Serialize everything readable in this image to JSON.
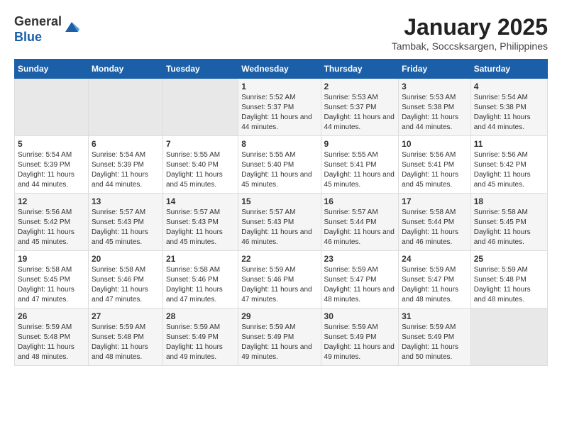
{
  "logo": {
    "general": "General",
    "blue": "Blue"
  },
  "title": "January 2025",
  "subtitle": "Tambak, Soccsksargen, Philippines",
  "headers": [
    "Sunday",
    "Monday",
    "Tuesday",
    "Wednesday",
    "Thursday",
    "Friday",
    "Saturday"
  ],
  "weeks": [
    [
      {
        "day": "",
        "sunrise": "",
        "sunset": "",
        "daylight": "",
        "empty": true
      },
      {
        "day": "",
        "sunrise": "",
        "sunset": "",
        "daylight": "",
        "empty": true
      },
      {
        "day": "",
        "sunrise": "",
        "sunset": "",
        "daylight": "",
        "empty": true
      },
      {
        "day": "1",
        "sunrise": "Sunrise: 5:52 AM",
        "sunset": "Sunset: 5:37 PM",
        "daylight": "Daylight: 11 hours and 44 minutes."
      },
      {
        "day": "2",
        "sunrise": "Sunrise: 5:53 AM",
        "sunset": "Sunset: 5:37 PM",
        "daylight": "Daylight: 11 hours and 44 minutes."
      },
      {
        "day": "3",
        "sunrise": "Sunrise: 5:53 AM",
        "sunset": "Sunset: 5:38 PM",
        "daylight": "Daylight: 11 hours and 44 minutes."
      },
      {
        "day": "4",
        "sunrise": "Sunrise: 5:54 AM",
        "sunset": "Sunset: 5:38 PM",
        "daylight": "Daylight: 11 hours and 44 minutes."
      }
    ],
    [
      {
        "day": "5",
        "sunrise": "Sunrise: 5:54 AM",
        "sunset": "Sunset: 5:39 PM",
        "daylight": "Daylight: 11 hours and 44 minutes."
      },
      {
        "day": "6",
        "sunrise": "Sunrise: 5:54 AM",
        "sunset": "Sunset: 5:39 PM",
        "daylight": "Daylight: 11 hours and 44 minutes."
      },
      {
        "day": "7",
        "sunrise": "Sunrise: 5:55 AM",
        "sunset": "Sunset: 5:40 PM",
        "daylight": "Daylight: 11 hours and 45 minutes."
      },
      {
        "day": "8",
        "sunrise": "Sunrise: 5:55 AM",
        "sunset": "Sunset: 5:40 PM",
        "daylight": "Daylight: 11 hours and 45 minutes."
      },
      {
        "day": "9",
        "sunrise": "Sunrise: 5:55 AM",
        "sunset": "Sunset: 5:41 PM",
        "daylight": "Daylight: 11 hours and 45 minutes."
      },
      {
        "day": "10",
        "sunrise": "Sunrise: 5:56 AM",
        "sunset": "Sunset: 5:41 PM",
        "daylight": "Daylight: 11 hours and 45 minutes."
      },
      {
        "day": "11",
        "sunrise": "Sunrise: 5:56 AM",
        "sunset": "Sunset: 5:42 PM",
        "daylight": "Daylight: 11 hours and 45 minutes."
      }
    ],
    [
      {
        "day": "12",
        "sunrise": "Sunrise: 5:56 AM",
        "sunset": "Sunset: 5:42 PM",
        "daylight": "Daylight: 11 hours and 45 minutes."
      },
      {
        "day": "13",
        "sunrise": "Sunrise: 5:57 AM",
        "sunset": "Sunset: 5:43 PM",
        "daylight": "Daylight: 11 hours and 45 minutes."
      },
      {
        "day": "14",
        "sunrise": "Sunrise: 5:57 AM",
        "sunset": "Sunset: 5:43 PM",
        "daylight": "Daylight: 11 hours and 45 minutes."
      },
      {
        "day": "15",
        "sunrise": "Sunrise: 5:57 AM",
        "sunset": "Sunset: 5:43 PM",
        "daylight": "Daylight: 11 hours and 46 minutes."
      },
      {
        "day": "16",
        "sunrise": "Sunrise: 5:57 AM",
        "sunset": "Sunset: 5:44 PM",
        "daylight": "Daylight: 11 hours and 46 minutes."
      },
      {
        "day": "17",
        "sunrise": "Sunrise: 5:58 AM",
        "sunset": "Sunset: 5:44 PM",
        "daylight": "Daylight: 11 hours and 46 minutes."
      },
      {
        "day": "18",
        "sunrise": "Sunrise: 5:58 AM",
        "sunset": "Sunset: 5:45 PM",
        "daylight": "Daylight: 11 hours and 46 minutes."
      }
    ],
    [
      {
        "day": "19",
        "sunrise": "Sunrise: 5:58 AM",
        "sunset": "Sunset: 5:45 PM",
        "daylight": "Daylight: 11 hours and 47 minutes."
      },
      {
        "day": "20",
        "sunrise": "Sunrise: 5:58 AM",
        "sunset": "Sunset: 5:46 PM",
        "daylight": "Daylight: 11 hours and 47 minutes."
      },
      {
        "day": "21",
        "sunrise": "Sunrise: 5:58 AM",
        "sunset": "Sunset: 5:46 PM",
        "daylight": "Daylight: 11 hours and 47 minutes."
      },
      {
        "day": "22",
        "sunrise": "Sunrise: 5:59 AM",
        "sunset": "Sunset: 5:46 PM",
        "daylight": "Daylight: 11 hours and 47 minutes."
      },
      {
        "day": "23",
        "sunrise": "Sunrise: 5:59 AM",
        "sunset": "Sunset: 5:47 PM",
        "daylight": "Daylight: 11 hours and 48 minutes."
      },
      {
        "day": "24",
        "sunrise": "Sunrise: 5:59 AM",
        "sunset": "Sunset: 5:47 PM",
        "daylight": "Daylight: 11 hours and 48 minutes."
      },
      {
        "day": "25",
        "sunrise": "Sunrise: 5:59 AM",
        "sunset": "Sunset: 5:48 PM",
        "daylight": "Daylight: 11 hours and 48 minutes."
      }
    ],
    [
      {
        "day": "26",
        "sunrise": "Sunrise: 5:59 AM",
        "sunset": "Sunset: 5:48 PM",
        "daylight": "Daylight: 11 hours and 48 minutes."
      },
      {
        "day": "27",
        "sunrise": "Sunrise: 5:59 AM",
        "sunset": "Sunset: 5:48 PM",
        "daylight": "Daylight: 11 hours and 48 minutes."
      },
      {
        "day": "28",
        "sunrise": "Sunrise: 5:59 AM",
        "sunset": "Sunset: 5:49 PM",
        "daylight": "Daylight: 11 hours and 49 minutes."
      },
      {
        "day": "29",
        "sunrise": "Sunrise: 5:59 AM",
        "sunset": "Sunset: 5:49 PM",
        "daylight": "Daylight: 11 hours and 49 minutes."
      },
      {
        "day": "30",
        "sunrise": "Sunrise: 5:59 AM",
        "sunset": "Sunset: 5:49 PM",
        "daylight": "Daylight: 11 hours and 49 minutes."
      },
      {
        "day": "31",
        "sunrise": "Sunrise: 5:59 AM",
        "sunset": "Sunset: 5:49 PM",
        "daylight": "Daylight: 11 hours and 50 minutes."
      },
      {
        "day": "",
        "sunrise": "",
        "sunset": "",
        "daylight": "",
        "empty": true
      }
    ]
  ]
}
